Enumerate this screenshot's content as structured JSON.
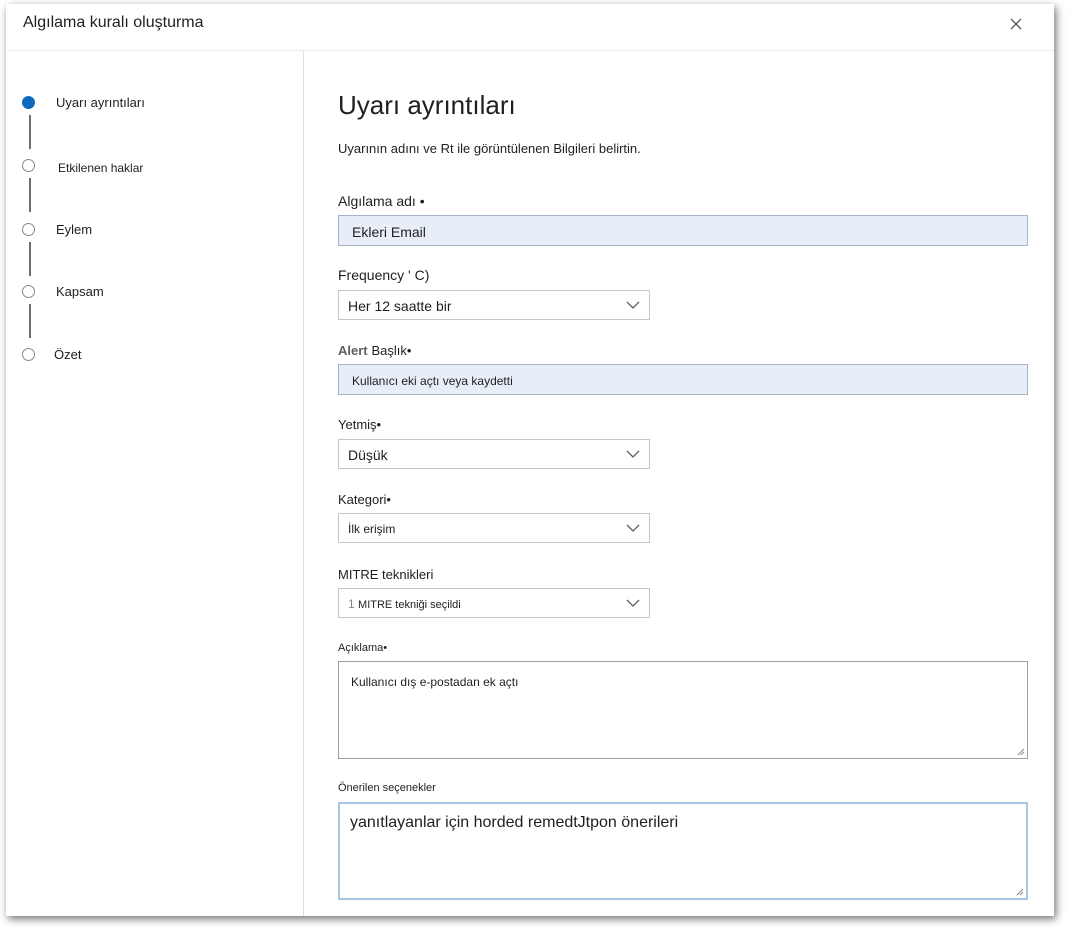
{
  "dialog": {
    "title": "Algılama kuralı oluşturma",
    "close_icon": "close-icon"
  },
  "steps": [
    {
      "label": "Uyarı ayrıntıları",
      "active": true
    },
    {
      "label": "Etkilenen haklar",
      "active": false
    },
    {
      "label": "Eylem",
      "active": false
    },
    {
      "label": "Kapsam",
      "active": false
    },
    {
      "label": "Özet",
      "active": false
    }
  ],
  "main": {
    "title": "Uyarı ayrıntıları",
    "subtitle": "Uyarının adını ve Rt ile görüntülenen Bilgileri belirtin.",
    "fields": {
      "detection_name": {
        "label": "Algılama adı •",
        "value": "Ekleri Email"
      },
      "frequency": {
        "label": "Frequency ' C)",
        "value": "Her 12 saatte bir"
      },
      "alert_title": {
        "prefix": "Alert",
        "label": "Başlık•",
        "value": "Kullanıcı eki açtı veya kaydetti"
      },
      "severity": {
        "label": "Yetmiş•",
        "value": "Düşük"
      },
      "category": {
        "label": "Kategori•",
        "value": "İlk erişim"
      },
      "mitre": {
        "label": "MITRE teknikleri",
        "count": "1",
        "value": "MITRE tekniği seçildi"
      },
      "description": {
        "label": "Açıklama•",
        "value": "Kullanıcı dış e-postadan ek açtı"
      },
      "recommended": {
        "label": "Önerilen seçenekler",
        "value": "yanıtlayanlar için horded remedtJtpon önerileri"
      }
    }
  },
  "colors": {
    "accent": "#0f6cbd",
    "input_fill": "#e8eef8"
  }
}
